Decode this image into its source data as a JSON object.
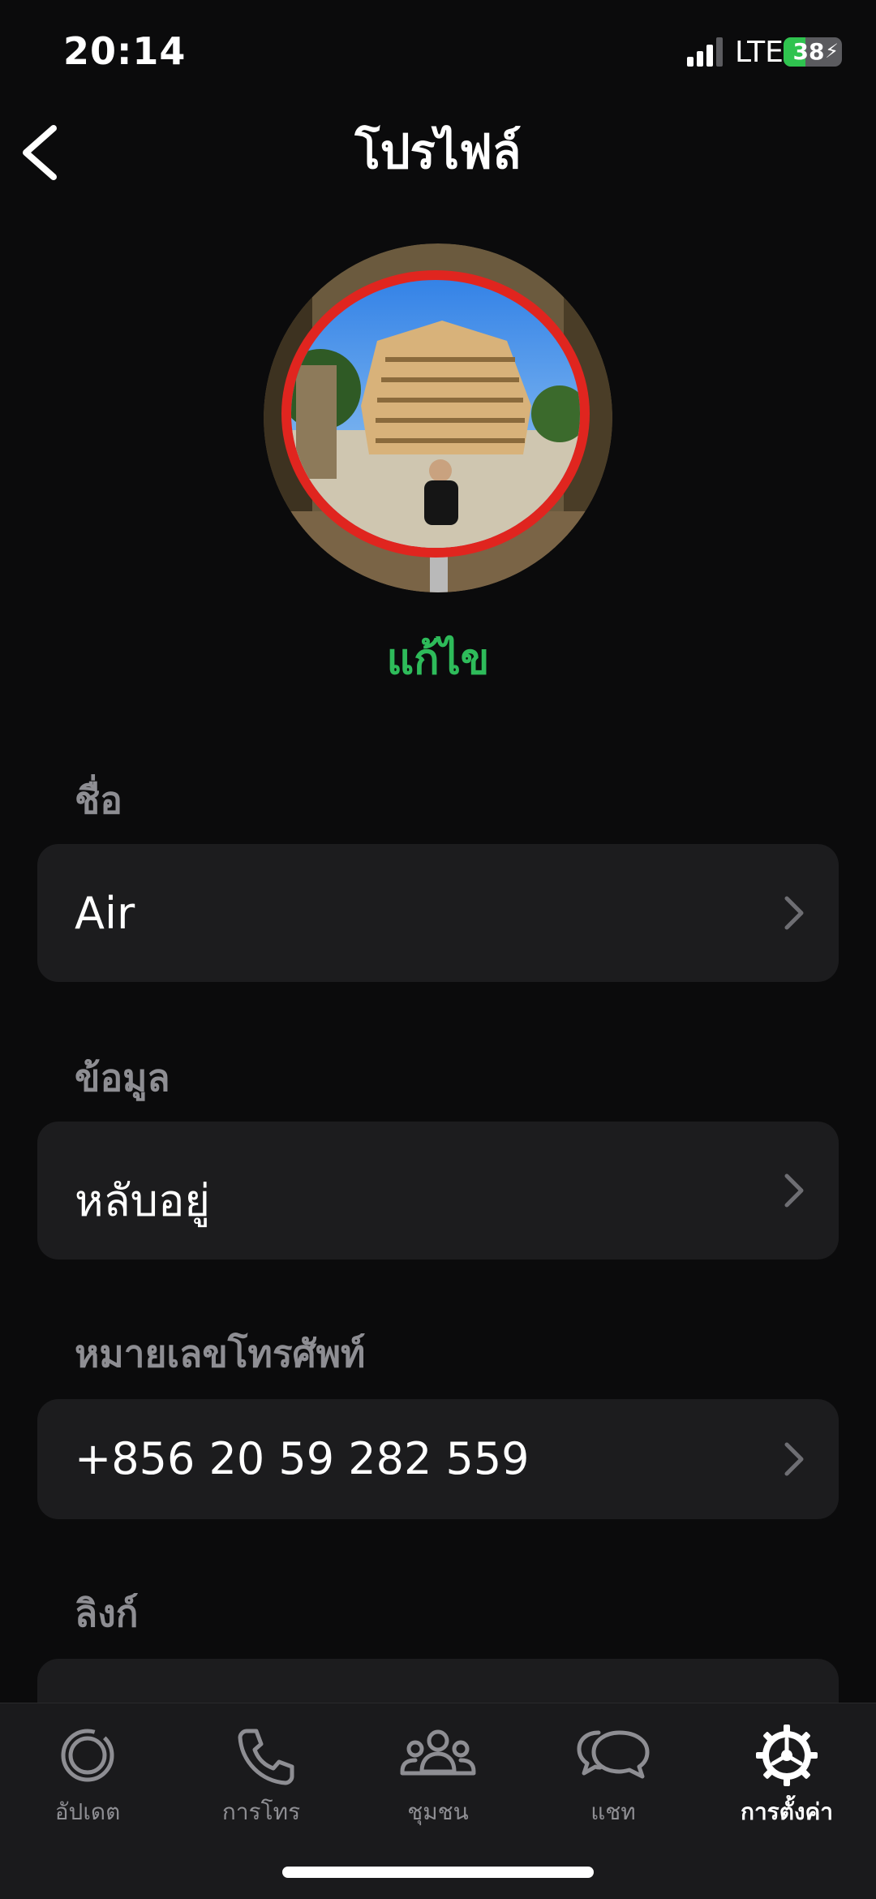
{
  "status_bar": {
    "time": "20:14",
    "network": "LTE",
    "battery_level": 38,
    "battery_text": "38",
    "charging": true
  },
  "header": {
    "title": "โปรไฟล์",
    "back_icon": "chevron-left-icon"
  },
  "profile": {
    "edit_label": "แก้ไข",
    "edit_color": "#2ebb5a"
  },
  "sections": {
    "name": {
      "label": "ชื่อ",
      "value": "Air"
    },
    "about": {
      "label": "ข้อมูล",
      "value": "หลับอยู่"
    },
    "phone": {
      "label": "หมายเลขโทรศัพท์",
      "value": "+856 20 59 282 559"
    },
    "links": {
      "label": "ลิงก์"
    }
  },
  "bottom_nav": {
    "items": [
      {
        "label": "อัปเดต",
        "icon": "updates-icon"
      },
      {
        "label": "การโทร",
        "icon": "phone-icon"
      },
      {
        "label": "ชุมชน",
        "icon": "communities-icon"
      },
      {
        "label": "แชท",
        "icon": "chats-icon"
      },
      {
        "label": "การตั้งค่า",
        "icon": "settings-icon",
        "active": true
      }
    ]
  },
  "colors": {
    "background": "#0b0b0c",
    "row_background": "#1c1c1e",
    "accent_green": "#2ebb5a",
    "muted": "#8e8e93"
  }
}
